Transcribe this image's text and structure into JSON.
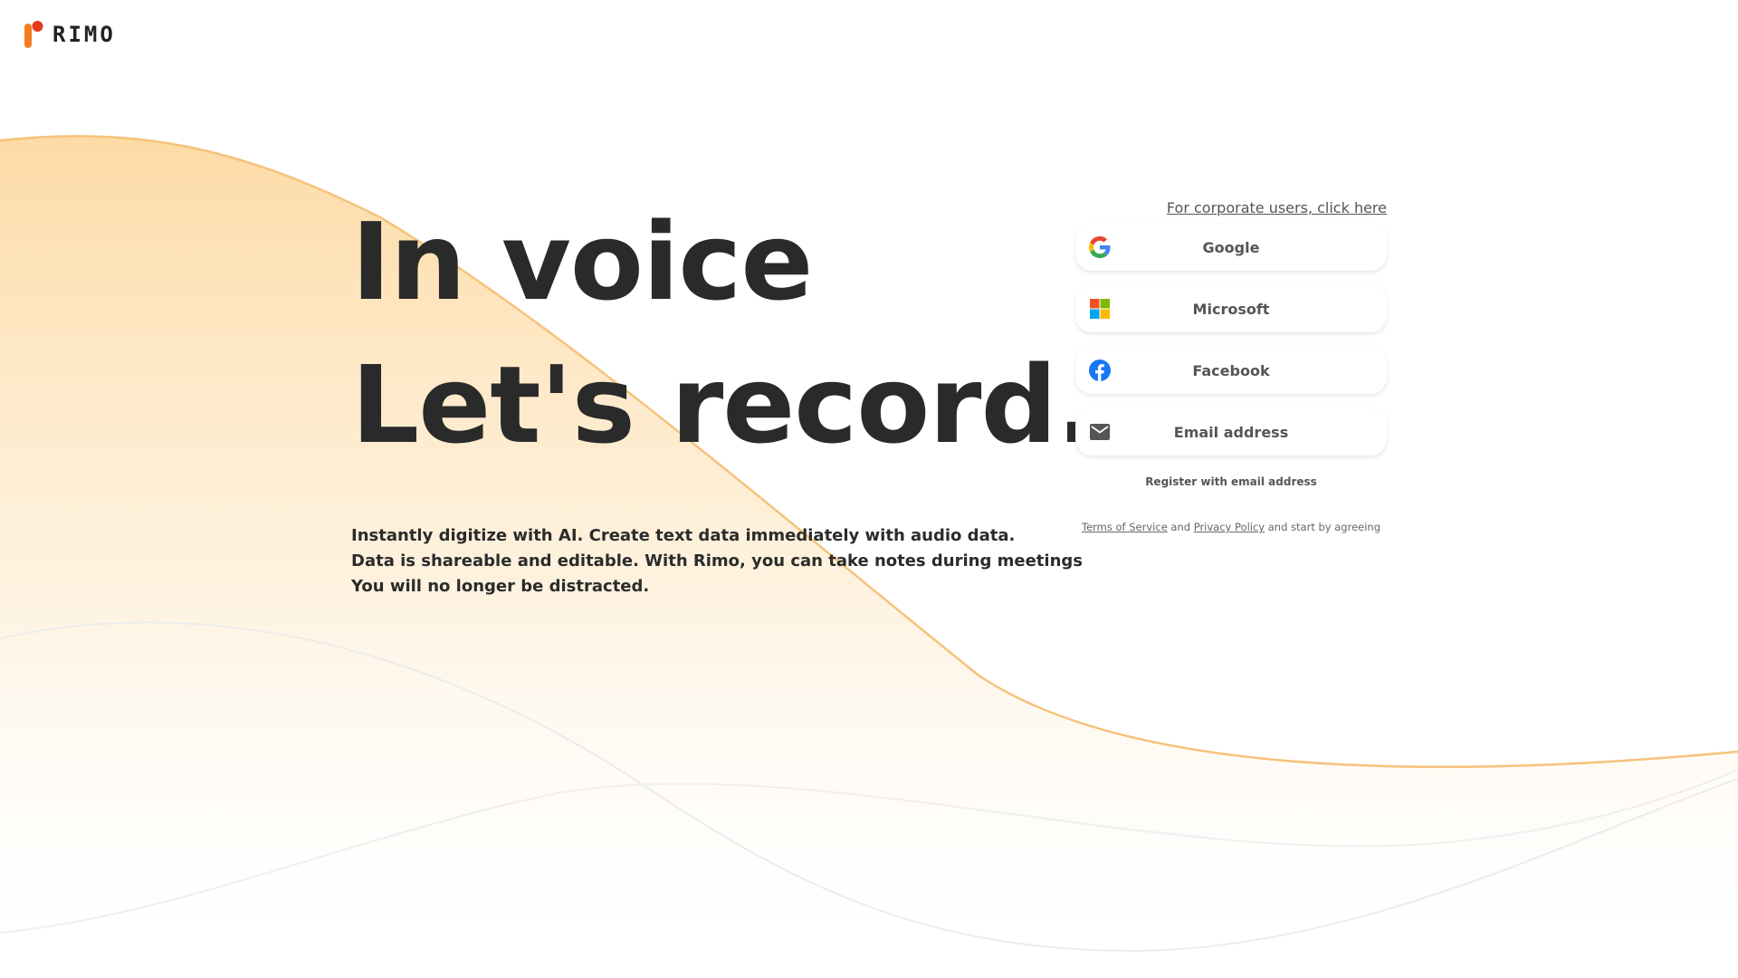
{
  "brand": {
    "name": "RIMO",
    "accent": "#f47c20",
    "accent_dot": "#e63a1e"
  },
  "hero": {
    "headline_line1": "In voice",
    "headline_line2": "Let's record.",
    "desc_line1": "Instantly digitize with AI. Create text data immediately with audio data.",
    "desc_line2": "Data is shareable and editable. With Rimo, you can take notes during meetings",
    "desc_line3": "You will no longer be distracted."
  },
  "login": {
    "corporate_link": "For corporate users, click here",
    "google_label": "Google",
    "microsoft_label": "Microsoft",
    "facebook_label": "Facebook",
    "email_label": "Email address",
    "register_label": "Register with email address",
    "terms_of_service": "Terms of Service",
    "and_text": " and ",
    "privacy_policy": "Privacy Policy",
    "agree_text": " and start by agreeing"
  },
  "colors": {
    "wave_fill_top": "#fde0b0",
    "wave_stroke": "#f6c27a",
    "text_dark": "#2a2a2a",
    "google_blue": "#4285F4",
    "google_red": "#EA4335",
    "google_yellow": "#FBBC05",
    "google_green": "#34A853",
    "ms_red": "#F25022",
    "ms_green": "#7FBA00",
    "ms_blue": "#00A4EF",
    "ms_yellow": "#FFB900",
    "facebook_blue": "#1877F2"
  }
}
